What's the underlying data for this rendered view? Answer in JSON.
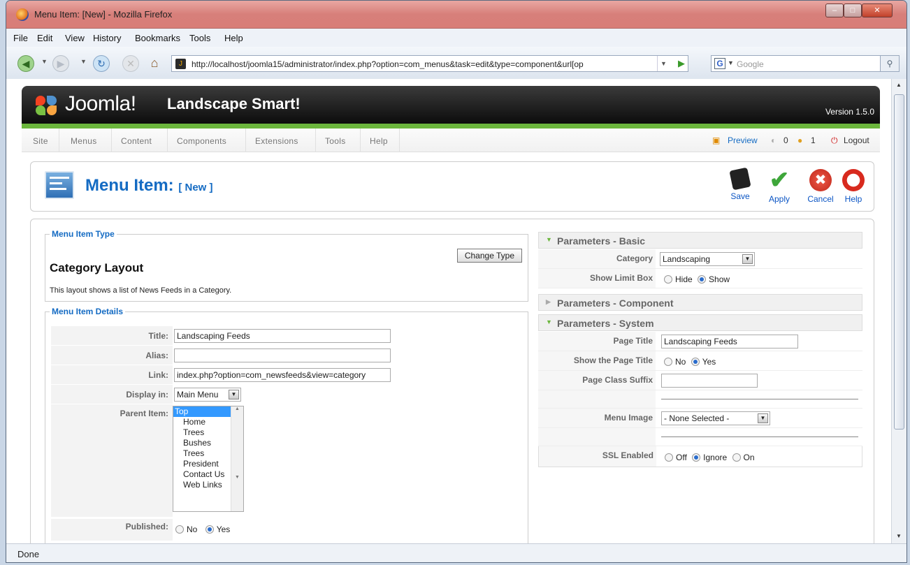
{
  "browser": {
    "title": "Menu Item: [New] - Mozilla Firefox",
    "menu": [
      "File",
      "Edit",
      "View",
      "History",
      "Bookmarks",
      "Tools",
      "Help"
    ],
    "url": "http://localhost/joomla15/administrator/index.php?option=com_menus&task=edit&type=component&url[op",
    "search_placeholder": "Google",
    "status": "Done"
  },
  "joomla": {
    "brand": "Joomla!",
    "site_name": "Landscape Smart!",
    "version": "Version 1.5.0",
    "menu": [
      "Site",
      "Menus",
      "Content",
      "Components",
      "Extensions",
      "Tools",
      "Help"
    ],
    "preview": "Preview",
    "messages_count": "0",
    "users_count": "1",
    "logout": "Logout"
  },
  "toolbar": {
    "title": "Menu Item:",
    "subtitle": "[ New ]",
    "buttons": [
      "Save",
      "Apply",
      "Cancel",
      "Help"
    ]
  },
  "item_type": {
    "legend": "Menu Item Type",
    "change_type": "Change Type",
    "layout": "Category Layout",
    "description": "This layout shows a list of News Feeds in a Category."
  },
  "details": {
    "legend": "Menu Item Details",
    "title_label": "Title:",
    "title_value": "Landscaping Feeds",
    "alias_label": "Alias:",
    "alias_value": "",
    "link_label": "Link:",
    "link_value": "index.php?option=com_newsfeeds&view=category",
    "display_label": "Display in:",
    "display_value": "Main Menu",
    "parent_label": "Parent Item:",
    "parent_items": [
      "Top",
      "Home",
      "Trees",
      "Bushes",
      "Trees",
      "President",
      "Contact Us",
      "Web Links"
    ],
    "published_label": "Published:",
    "no": "No",
    "yes": "Yes"
  },
  "params_basic": {
    "title": "Parameters - Basic",
    "category_label": "Category",
    "category_value": "Landscaping",
    "limit_label": "Show Limit Box",
    "hide": "Hide",
    "show": "Show"
  },
  "params_component": {
    "title": "Parameters - Component"
  },
  "params_system": {
    "title": "Parameters - System",
    "page_title_label": "Page Title",
    "page_title_value": "Landscaping Feeds",
    "show_title_label": "Show the Page Title",
    "no": "No",
    "yes": "Yes",
    "suffix_label": "Page Class Suffix",
    "image_label": "Menu Image",
    "image_value": "- None Selected -",
    "ssl_label": "SSL Enabled",
    "off": "Off",
    "ignore": "Ignore",
    "on": "On"
  }
}
